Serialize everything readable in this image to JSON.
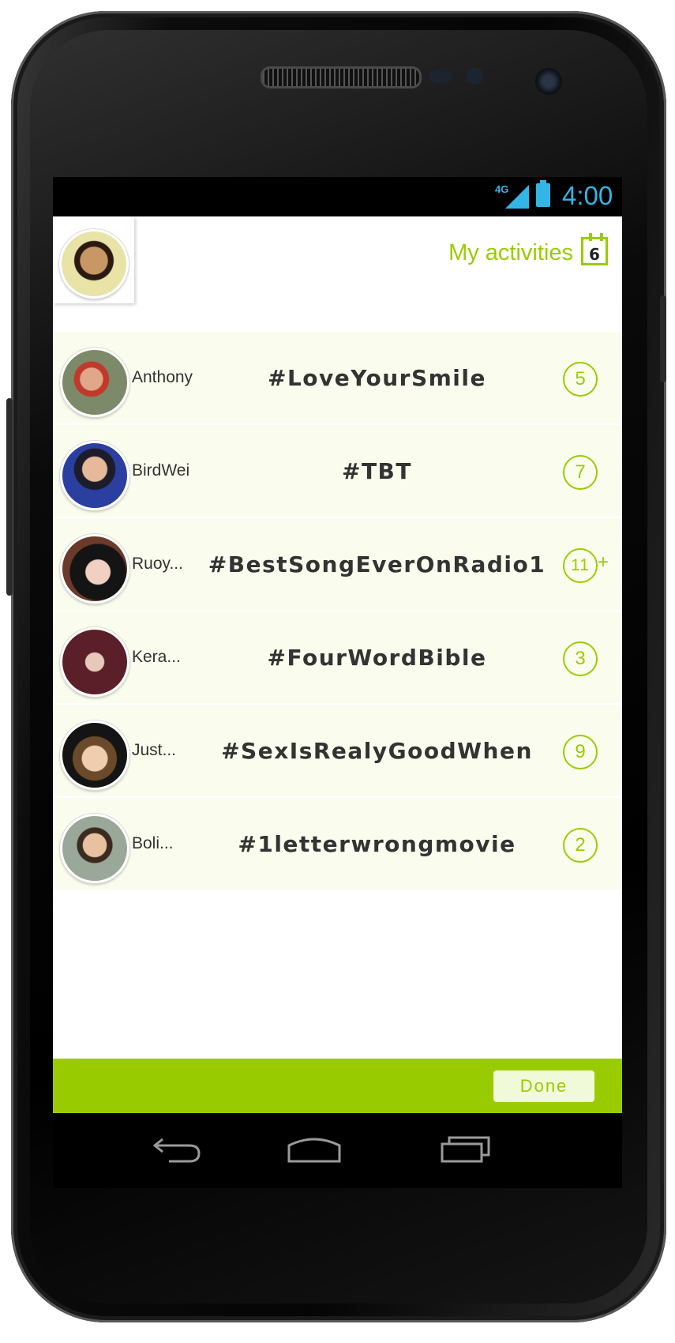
{
  "status_bar": {
    "network": "4G",
    "time": "4:00"
  },
  "header": {
    "activities_label": "My activities",
    "activities_count": "6"
  },
  "rows": [
    {
      "name": "Anthony",
      "hashtag": "#LoveYourSmile",
      "count": "5"
    },
    {
      "name": "BirdWei",
      "hashtag": "#TBT",
      "count": "7"
    },
    {
      "name": "Ruoy...",
      "hashtag": "#BestSongEverOnRadio1",
      "count": "11",
      "extra": "+"
    },
    {
      "name": "Kera...",
      "hashtag": "#FourWordBible",
      "count": "3"
    },
    {
      "name": "Just...",
      "hashtag": "#SexIsRealyGoodWhen",
      "count": "9"
    },
    {
      "name": "Boli...",
      "hashtag": "#1letterwrongmovie",
      "count": "2"
    }
  ],
  "footer": {
    "done_label": "Done"
  },
  "colors": {
    "accent": "#99cc00",
    "row_bg": "#fafdee",
    "status": "#33b5e5"
  },
  "icons": {
    "back": "back-icon",
    "home": "home-icon",
    "recents": "recents-icon",
    "calendar": "calendar-icon"
  }
}
